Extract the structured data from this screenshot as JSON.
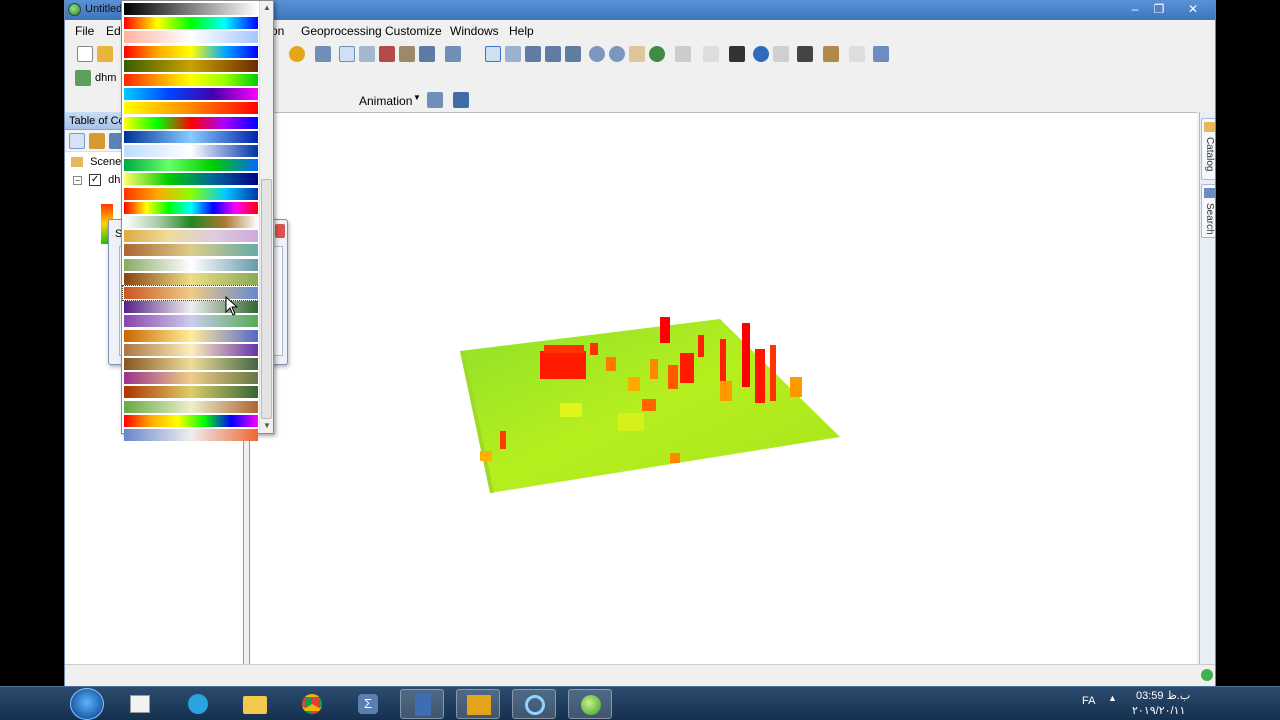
{
  "window": {
    "title": "Untitled"
  },
  "menus": {
    "file": "File",
    "edit": "Edi",
    "selection_tail": "on",
    "geoprocessing": "Geoprocessing",
    "customize": "Customize",
    "windows": "Windows",
    "help": "Help"
  },
  "toolbar": {
    "layer_name": "dhm",
    "animation_label": "Animation"
  },
  "toc": {
    "header": "Table of Co",
    "scene_layers": "Scene l",
    "layer": "dhr"
  },
  "dialog": {
    "title": "S"
  },
  "dock": {
    "catalog": "Catalog",
    "search": "Search"
  },
  "tray": {
    "lang": "FA",
    "time": "03:59 ب.ظ",
    "date": "۲۰۱۹/۲۰/۱۱"
  },
  "ramps": [
    [
      "#000000",
      "#ffffff"
    ],
    [
      "#ff0000",
      "#ffff00",
      "#00ff00",
      "#00ffff",
      "#0000ff"
    ],
    [
      "#ffb3a3",
      "#ffffff",
      "#a3c8ff"
    ],
    [
      "#ff0000",
      "#ffaa00",
      "#ffff00",
      "#00aaff",
      "#0000ff"
    ],
    [
      "#3a5c00",
      "#c9a200",
      "#6b2a00"
    ],
    [
      "#ff2200",
      "#ff9900",
      "#ffff00",
      "#99ff00",
      "#00cc00"
    ],
    [
      "#00ccff",
      "#0044ff",
      "#4400aa",
      "#ff00ff"
    ],
    [
      "#ffff00",
      "#ff8800",
      "#ff0000"
    ],
    [
      "#ffff00",
      "#00ff00",
      "#ff0000",
      "#aa00ff",
      "#0000ff"
    ],
    [
      "#003399",
      "#88ccff",
      "#0022aa"
    ],
    [
      "#bbddff",
      "#ffffff",
      "#0033aa"
    ],
    [
      "#00aa44",
      "#66ff66",
      "#00cc00",
      "#0066ff"
    ],
    [
      "#ffff66",
      "#00cc00",
      "#006699",
      "#000088"
    ],
    [
      "#ff3300",
      "#ffaa00",
      "#88ff00",
      "#00ccff",
      "#0033aa"
    ],
    [
      "#ff0000",
      "#ffff00",
      "#00ff00",
      "#00ffff",
      "#0000ff",
      "#ff00ff",
      "#ff0000"
    ],
    [
      "#ffffff",
      "#aaccaa",
      "#228822",
      "#aa7733",
      "#ffffff"
    ],
    [
      "#ddaa44",
      "#eedd99",
      "#ddccdd",
      "#ccaadd"
    ],
    [
      "#aa6633",
      "#ddcc88",
      "#66aaaa"
    ],
    [
      "#88aa66",
      "#ffffff",
      "#6699aa"
    ],
    [
      "#884411",
      "#eedd88",
      "#88aa55"
    ],
    [
      "#cc5522",
      "#eecc88",
      "#6688cc"
    ],
    [
      "#552288",
      "#eeeeee",
      "#336633"
    ],
    [
      "#8844aa",
      "#ccccee",
      "#55aa55"
    ],
    [
      "#cc6600",
      "#ffee99",
      "#5566cc"
    ],
    [
      "#aa7744",
      "#ffeebb",
      "#6633aa"
    ],
    [
      "#885522",
      "#eedd99",
      "#446644"
    ],
    [
      "#993388",
      "#eecc88",
      "#667744"
    ],
    [
      "#aa3300",
      "#ddcc66",
      "#336633"
    ],
    [
      "#66aa44",
      "#eeeecc",
      "#aa6633"
    ],
    [
      "#ff0000",
      "#ffaa00",
      "#ffff00",
      "#00ff00",
      "#0000ff",
      "#ff00ff"
    ],
    [
      "#6688cc",
      "#eeeeee",
      "#ee6633"
    ]
  ]
}
